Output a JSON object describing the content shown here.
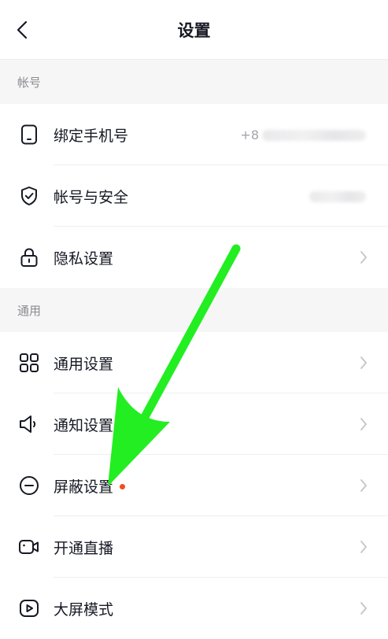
{
  "header": {
    "title": "设置",
    "back_icon": "chevron-left-icon"
  },
  "sections": [
    {
      "title": "帐号",
      "items": [
        {
          "label": "绑定手机号",
          "icon": "phone-icon",
          "value": "+8"
        },
        {
          "label": "帐号与安全",
          "icon": "shield-check-icon",
          "value": ""
        },
        {
          "label": "隐私设置",
          "icon": "lock-icon",
          "value": ""
        }
      ]
    },
    {
      "title": "通用",
      "items": [
        {
          "label": "通用设置",
          "icon": "grid-icon"
        },
        {
          "label": "通知设置",
          "icon": "speaker-icon"
        },
        {
          "label": "屏蔽设置",
          "icon": "block-icon",
          "badge": "red-dot"
        },
        {
          "label": "开通直播",
          "icon": "video-camera-icon"
        },
        {
          "label": "大屏模式",
          "icon": "play-screen-icon"
        }
      ]
    }
  ],
  "colors": {
    "accent_arrow": "#22ee22",
    "badge_dot": "#f04e23",
    "section_bg": "#f6f6f6",
    "muted_text": "#8a8b91"
  }
}
